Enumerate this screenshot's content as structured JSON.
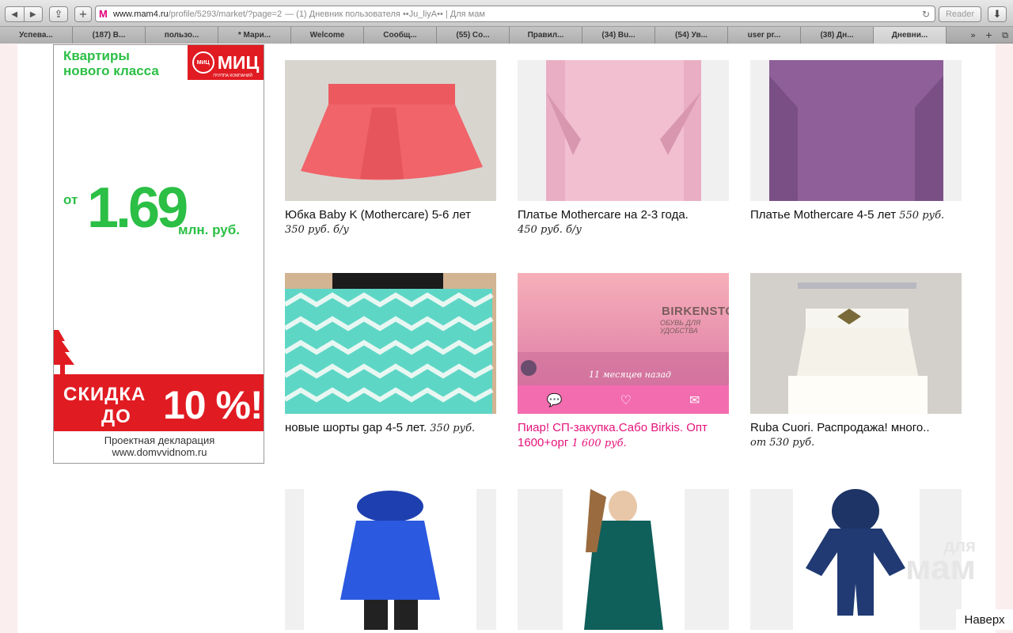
{
  "browser": {
    "url_host": "www.mam4.ru",
    "url_path": "/profile/5293/market/?page=2",
    "page_title": "— (1) Дневник пользователя ••Ju_liyA•• | Для мам",
    "reader_label": "Reader",
    "tabs": [
      "Успева...",
      "(187) В...",
      "пользо...",
      "* Мари...",
      "Welcome",
      "Сообщ...",
      "(55) Со...",
      "Правил...",
      "(34) Bu...",
      "(54) Ув...",
      "user pr...",
      "(38) Дн...",
      "Дневни..."
    ],
    "active_tab": 12
  },
  "ad": {
    "headline_1": "Квартиры",
    "headline_2": "нового класса",
    "logo_name": "МИЦ",
    "logo_ring": "МИЦ",
    "logo_sub": "ГРУППА КОМПАНИЙ",
    "price_prefix": "от",
    "price_value": "1.69",
    "price_unit": "млн. руб.",
    "banner_line1": "СКИДКА",
    "banner_line2": "ДО",
    "banner_percent": "10 %!",
    "footer_1": "Проектная декларация",
    "footer_2": "www.domvvidnom.ru"
  },
  "items": [
    {
      "title": "Юбка Baby K (Mothercare) 5-6 лет",
      "price": "350 руб. б/у",
      "price_inline": false
    },
    {
      "title": "Платье Mothercare на 2-3 года.",
      "price": "450 руб. б/у",
      "price_inline": false
    },
    {
      "title": "Платье Mothercare 4-5 лет",
      "price": "550 руб.",
      "price_inline": true
    },
    {
      "title": "новые шорты gap 4-5 лет.",
      "price": "350 руб.",
      "price_inline": true
    },
    {
      "title": "Пиар! СП-закупка.Сабо Birkis. Опт 1600+орг",
      "price": "1 600 руб.",
      "price_inline": true,
      "promo": true
    },
    {
      "title": "Ruba Cuori. Распродажа! много..",
      "price": "от 530 руб.",
      "price_inline": false
    }
  ],
  "promo": {
    "brand": "BIRKENSTOCK",
    "slogan": "ОБУВЬ ДЛЯ УДОБСТВА",
    "time_ago": "11 месяцев назад"
  },
  "watermark": {
    "small": "для",
    "big": "мам"
  },
  "back_to_top": "Наверх",
  "colors": {
    "accent_pink": "#e4127a",
    "ad_green": "#2bbf45",
    "ad_red": "#e11b22"
  }
}
